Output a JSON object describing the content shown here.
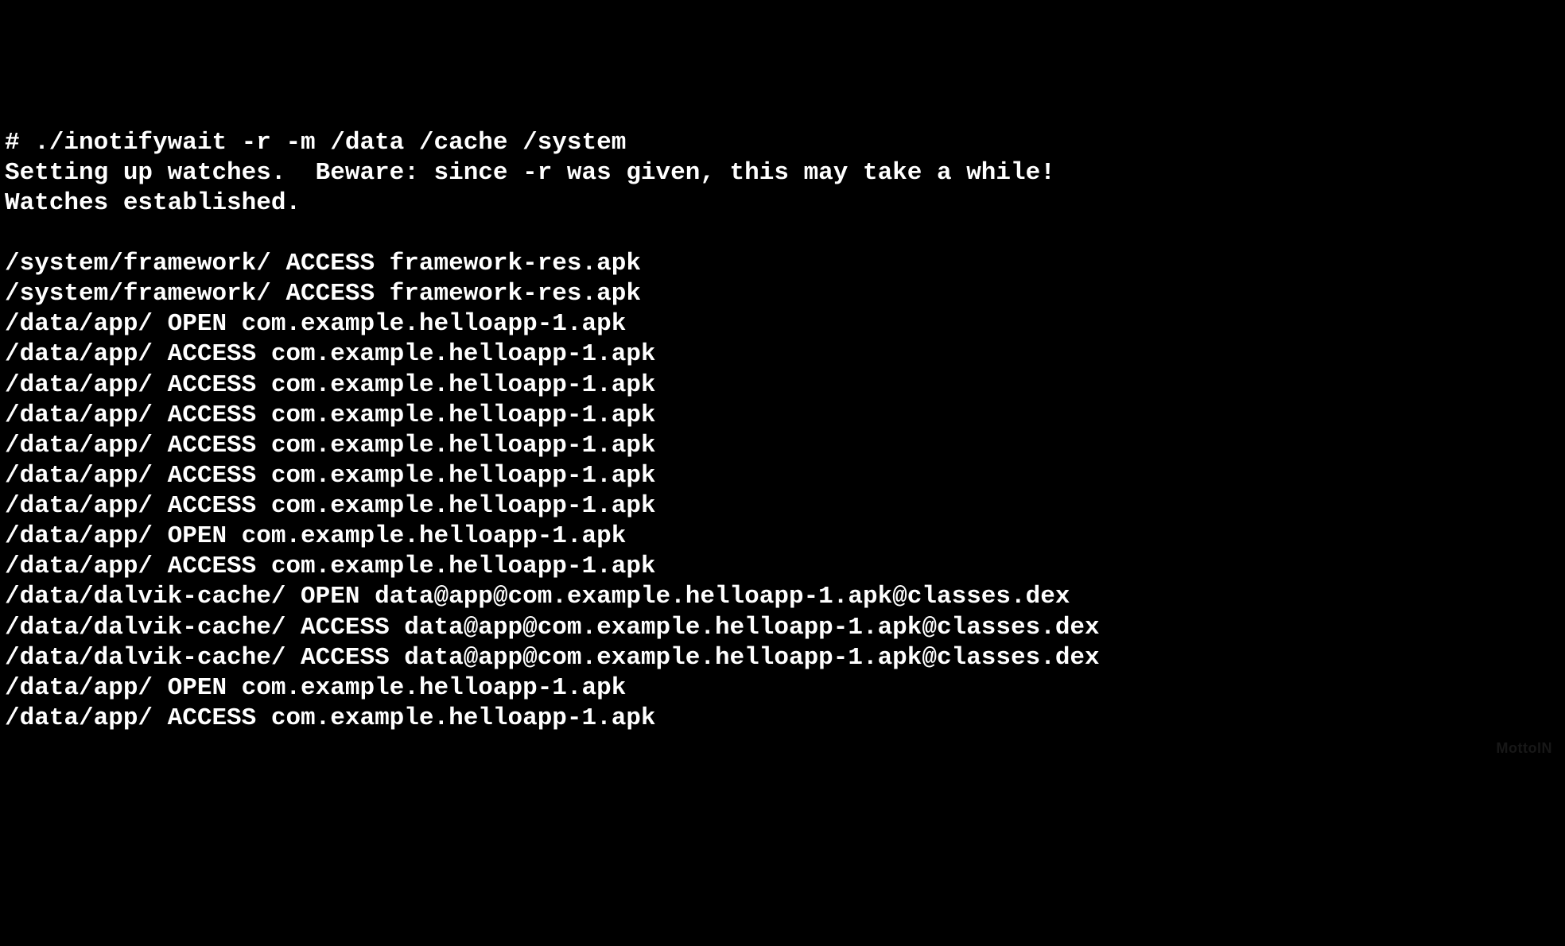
{
  "terminal": {
    "lines": [
      "# ./inotifywait -r -m /data /cache /system",
      "Setting up watches.  Beware: since -r was given, this may take a while!",
      "Watches established.",
      "",
      "/system/framework/ ACCESS framework-res.apk",
      "/system/framework/ ACCESS framework-res.apk",
      "/data/app/ OPEN com.example.helloapp-1.apk",
      "/data/app/ ACCESS com.example.helloapp-1.apk",
      "/data/app/ ACCESS com.example.helloapp-1.apk",
      "/data/app/ ACCESS com.example.helloapp-1.apk",
      "/data/app/ ACCESS com.example.helloapp-1.apk",
      "/data/app/ ACCESS com.example.helloapp-1.apk",
      "/data/app/ ACCESS com.example.helloapp-1.apk",
      "/data/app/ OPEN com.example.helloapp-1.apk",
      "/data/app/ ACCESS com.example.helloapp-1.apk",
      "/data/dalvik-cache/ OPEN data@app@com.example.helloapp-1.apk@classes.dex",
      "/data/dalvik-cache/ ACCESS data@app@com.example.helloapp-1.apk@classes.dex",
      "/data/dalvik-cache/ ACCESS data@app@com.example.helloapp-1.apk@classes.dex",
      "/data/app/ OPEN com.example.helloapp-1.apk",
      "/data/app/ ACCESS com.example.helloapp-1.apk"
    ]
  },
  "watermark": "MottoIN"
}
